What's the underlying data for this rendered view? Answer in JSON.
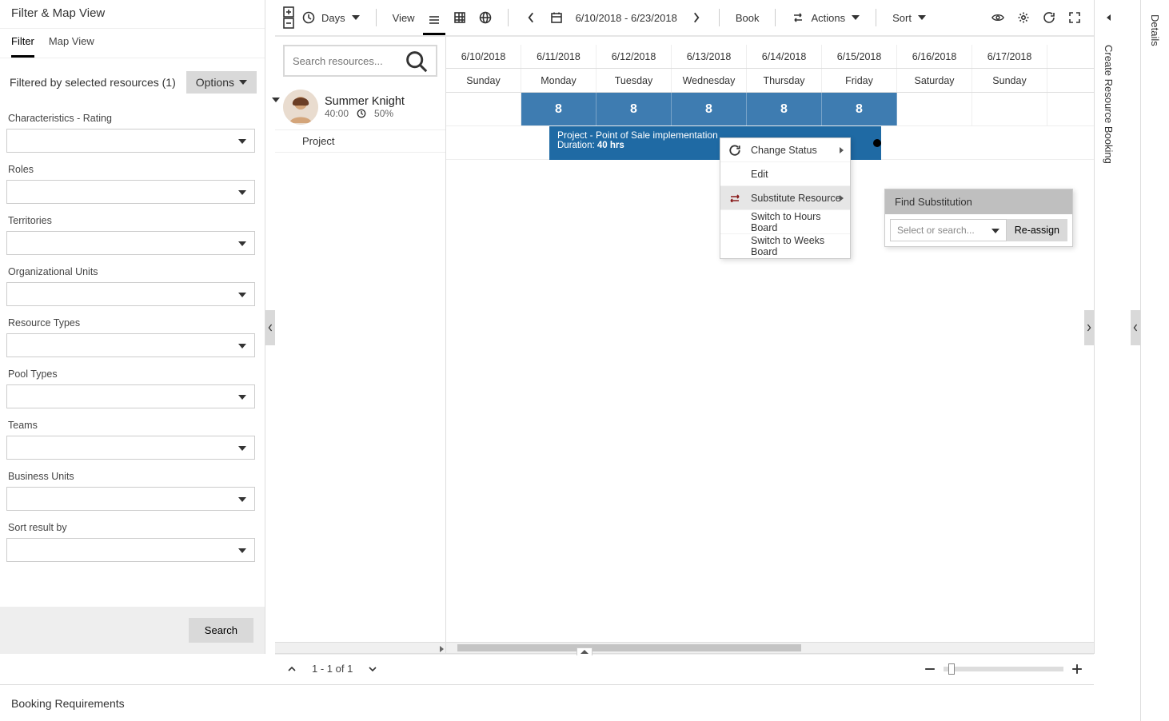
{
  "filterPanel": {
    "title": "Filter & Map View",
    "tabs": {
      "filter": "Filter",
      "map": "Map View"
    },
    "caption": "Filtered by selected resources (1)",
    "optionsLabel": "Options",
    "fields": [
      "Characteristics - Rating",
      "Roles",
      "Territories",
      "Organizational Units",
      "Resource Types",
      "Pool Types",
      "Teams",
      "Business Units",
      "Sort result by"
    ],
    "searchLabel": "Search"
  },
  "toolbar": {
    "days": "Days",
    "view": "View",
    "dateRange": "6/10/2018 - 6/23/2018",
    "book": "Book",
    "actions": "Actions",
    "sort": "Sort"
  },
  "board": {
    "searchPlaceholder": "Search resources...",
    "resource": {
      "name": "Summer Knight",
      "hours": "40:00",
      "pct": "50%"
    },
    "projectLabel": "Project",
    "dates": [
      "6/10/2018",
      "6/11/2018",
      "6/12/2018",
      "6/13/2018",
      "6/14/2018",
      "6/15/2018",
      "6/16/2018",
      "6/17/2018"
    ],
    "days": [
      "Sunday",
      "Monday",
      "Tuesday",
      "Wednesday",
      "Thursday",
      "Friday",
      "Saturday",
      "Sunday"
    ],
    "hoursValues": [
      "",
      "8",
      "8",
      "8",
      "8",
      "8",
      "",
      ""
    ],
    "task": {
      "title": "Project - Point of Sale implementation",
      "durationLabel": "Duration:",
      "durationValue": "40 hrs"
    }
  },
  "contextMenu": {
    "changeStatus": "Change Status",
    "edit": "Edit",
    "substitute": "Substitute Resource",
    "switchHours": "Switch to Hours Board",
    "switchWeeks": "Switch to Weeks Board"
  },
  "subPopover": {
    "title": "Find Substitution",
    "placeholder": "Select or search...",
    "button": "Re-assign"
  },
  "status": {
    "paging": "1 - 1 of 1"
  },
  "createStrip": "Create Resource Booking",
  "detailsStrip": "Details",
  "bookingReq": "Booking Requirements"
}
